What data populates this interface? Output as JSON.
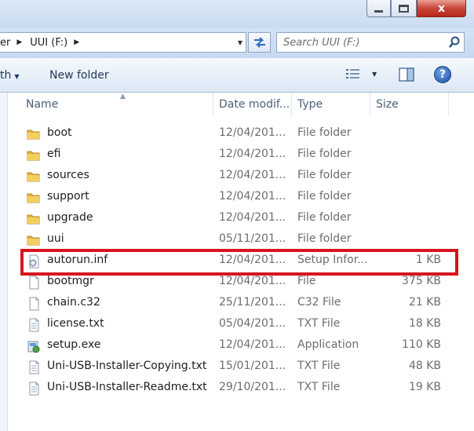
{
  "titlebar": {
    "close_glyph": "x"
  },
  "address": {
    "crumbs": [
      {
        "label": "er"
      },
      {
        "label": "UUI (F:)"
      }
    ]
  },
  "search": {
    "placeholder": "Search UUI (F:)"
  },
  "toolbar": {
    "share_label": "th",
    "new_folder_label": "New folder"
  },
  "columns": {
    "name": "Name",
    "date": "Date modif...",
    "type": "Type",
    "size": "Size"
  },
  "files": [
    {
      "name": "boot",
      "date": "12/04/201...",
      "type": "File folder",
      "size": "",
      "icon": "folder-icon"
    },
    {
      "name": "efi",
      "date": "12/04/201...",
      "type": "File folder",
      "size": "",
      "icon": "folder-icon"
    },
    {
      "name": "sources",
      "date": "12/04/201...",
      "type": "File folder",
      "size": "",
      "icon": "folder-icon"
    },
    {
      "name": "support",
      "date": "12/04/201...",
      "type": "File folder",
      "size": "",
      "icon": "folder-icon"
    },
    {
      "name": "upgrade",
      "date": "12/04/201...",
      "type": "File folder",
      "size": "",
      "icon": "folder-icon"
    },
    {
      "name": "uui",
      "date": "05/11/201...",
      "type": "File folder",
      "size": "",
      "icon": "folder-icon"
    },
    {
      "name": "autorun.inf",
      "date": "12/04/201...",
      "type": "Setup Infor...",
      "size": "1 KB",
      "icon": "setup-info-icon"
    },
    {
      "name": "bootmgr",
      "date": "12/04/201...",
      "type": "File",
      "size": "375 KB",
      "icon": "blank-file-icon"
    },
    {
      "name": "chain.c32",
      "date": "25/11/201...",
      "type": "C32 File",
      "size": "21 KB",
      "icon": "blank-file-icon"
    },
    {
      "name": "license.txt",
      "date": "05/04/201...",
      "type": "TXT File",
      "size": "18 KB",
      "icon": "text-file-icon"
    },
    {
      "name": "setup.exe",
      "date": "12/04/201...",
      "type": "Application",
      "size": "110 KB",
      "icon": "setup-exe-icon"
    },
    {
      "name": "Uni-USB-Installer-Copying.txt",
      "date": "15/01/201...",
      "type": "TXT File",
      "size": "48 KB",
      "icon": "text-file-icon"
    },
    {
      "name": "Uni-USB-Installer-Readme.txt",
      "date": "29/10/201...",
      "type": "TXT File",
      "size": "19 KB",
      "icon": "text-file-icon"
    }
  ],
  "highlight_color": "#d7141e"
}
